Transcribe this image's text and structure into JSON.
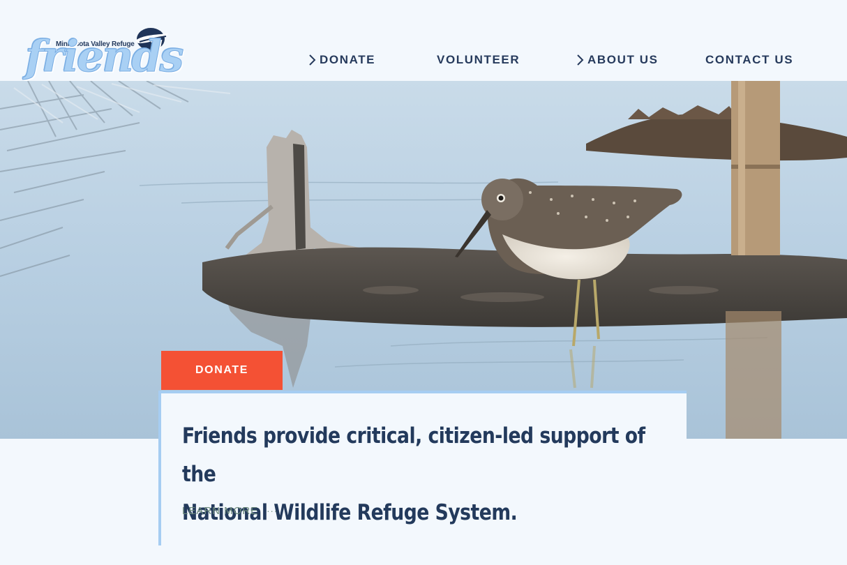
{
  "brand": {
    "subtitle": "Minnesota Valley Refuge",
    "wordmark": "friends"
  },
  "nav": {
    "items": [
      {
        "label": "DONATE",
        "has_chevron": true
      },
      {
        "label": "VOLUNTEER",
        "has_chevron": false
      },
      {
        "label": "ABOUT US",
        "has_chevron": true
      },
      {
        "label": "CONTACT US",
        "has_chevron": false
      }
    ]
  },
  "hero": {
    "donate_label": "DONATE",
    "headline_line1": "Friends provide critical, citizen-led support of the",
    "headline_line2": "National Wildlife Refuge System.",
    "learn_more_label": "LEARN MORE",
    "learn_more_icon": "ellipsis-icon"
  },
  "colors": {
    "accent": "#f45134",
    "navy": "#263a5c",
    "light_blue": "#a6cdf2",
    "background": "#f3f8fd"
  }
}
